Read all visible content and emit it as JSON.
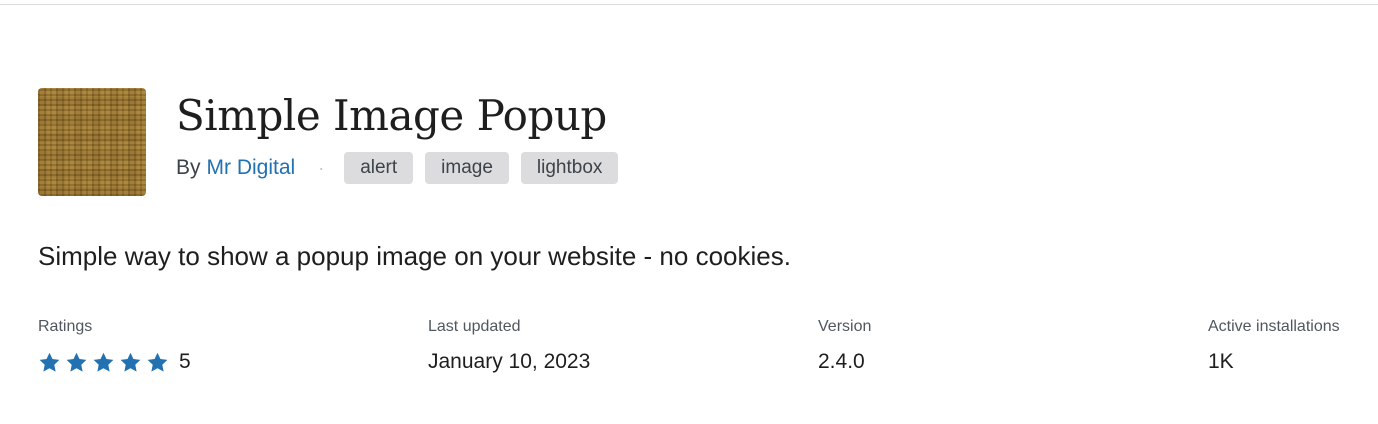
{
  "plugin": {
    "title": "Simple Image Popup",
    "by_label": "By",
    "author": "Mr Digital",
    "separator": "·",
    "tags": [
      "alert",
      "image",
      "lightbox"
    ],
    "description": "Simple way to show a popup image on your website - no cookies."
  },
  "meta": {
    "ratings": {
      "label": "Ratings",
      "stars": 5,
      "value": "5",
      "star_color": "#2271b1"
    },
    "last_updated": {
      "label": "Last updated",
      "value": "January 10, 2023"
    },
    "version": {
      "label": "Version",
      "value": "2.4.0"
    },
    "active_installations": {
      "label": "Active installations",
      "value": "1K"
    }
  },
  "colors": {
    "link": "#2271b1",
    "tag_bg": "#dcdcde",
    "text": "#1e1e1e"
  }
}
